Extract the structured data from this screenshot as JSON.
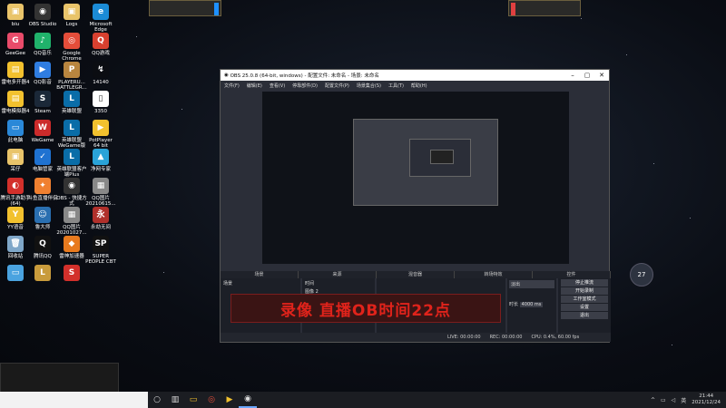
{
  "desktop_icons": [
    {
      "label": "biu",
      "color": "#e9c46a",
      "glyph": "▣"
    },
    {
      "label": "OBS Studio",
      "color": "#333333",
      "glyph": "◉"
    },
    {
      "label": "Logs",
      "color": "#e9c46a",
      "glyph": "▣"
    },
    {
      "label": "Microsoft Edge",
      "color": "#1b8bd6",
      "glyph": "e"
    },
    {
      "label": "GeeGee",
      "color": "#e94b6a",
      "glyph": "G"
    },
    {
      "label": "QQ音乐",
      "color": "#20b26b",
      "glyph": "♪"
    },
    {
      "label": "Google Chrome",
      "color": "#e44d3a",
      "glyph": "◎"
    },
    {
      "label": "QQ游戏",
      "color": "#d8402f",
      "glyph": "Q"
    },
    {
      "label": "雷电多开器4",
      "color": "#f2c12e",
      "glyph": "▤"
    },
    {
      "label": "QQ影音",
      "color": "#2f7de1",
      "glyph": "▶"
    },
    {
      "label": "PLAYERU... BATTLEGR...",
      "color": "#b8853f",
      "glyph": "P"
    },
    {
      "label": "14140",
      "color": "#0b0d12",
      "glyph": "↯"
    },
    {
      "label": "雷电模拟器4",
      "color": "#f2c12e",
      "glyph": "▤"
    },
    {
      "label": "Steam",
      "color": "#1b2838",
      "glyph": "S"
    },
    {
      "label": "英雄联盟",
      "color": "#0a6da8",
      "glyph": "L"
    },
    {
      "label": "3350",
      "color": "#ffffff",
      "glyph": "▯"
    },
    {
      "label": "此电脑",
      "color": "#2a88d8",
      "glyph": "▭"
    },
    {
      "label": "WeGame",
      "color": "#cc2b2b",
      "glyph": "W"
    },
    {
      "label": "英雄联盟 WeGame版",
      "color": "#0a6da8",
      "glyph": "L"
    },
    {
      "label": "PotPlayer 64 bit",
      "color": "#f2c12e",
      "glyph": "▶"
    },
    {
      "label": "呆仔",
      "color": "#e9c46a",
      "glyph": "▣"
    },
    {
      "label": "电脑管家",
      "color": "#1f72d1",
      "glyph": "✓"
    },
    {
      "label": "英雄联盟客户端Plus",
      "color": "#0a6da8",
      "glyph": "L"
    },
    {
      "label": "净网专家",
      "color": "#2aa3d8",
      "glyph": "▲"
    },
    {
      "label": "腾讯手游助手(64)",
      "color": "#d3302b",
      "glyph": "◐"
    },
    {
      "label": "斗鱼直播伴侣",
      "color": "#f08030",
      "glyph": "✦"
    },
    {
      "label": "OBS - 快捷方式",
      "color": "#333333",
      "glyph": "◉"
    },
    {
      "label": "QQ图片 20210615...",
      "color": "#888888",
      "glyph": "▦"
    },
    {
      "label": "YY语音",
      "color": "#f2c12e",
      "glyph": "Y"
    },
    {
      "label": "鲁大师",
      "color": "#2a6fb0",
      "glyph": "☺"
    },
    {
      "label": "QQ图片 20201027...",
      "color": "#888888",
      "glyph": "▦"
    },
    {
      "label": "永劫无间",
      "color": "#b0302b",
      "glyph": "永"
    },
    {
      "label": "回收站",
      "color": "#7fa7c9",
      "glyph": "🗑"
    },
    {
      "label": "腾讯QQ",
      "color": "#111111",
      "glyph": "Q"
    },
    {
      "label": "雷神加速器",
      "color": "#e87a1e",
      "glyph": "◆"
    },
    {
      "label": "SUPER PEOPLE CBT",
      "color": "#111111",
      "glyph": "SP"
    },
    {
      "label": "",
      "color": "#4aa3e0",
      "glyph": "▭"
    },
    {
      "label": "",
      "color": "#c89b3c",
      "glyph": "L"
    },
    {
      "label": "",
      "color": "#d3302b",
      "glyph": "S"
    }
  ],
  "obs": {
    "title": "OBS 25.0.8 (64-bit, windows) - 配置文件: 未命名 - 场景: 未命名",
    "menu": [
      "文件(F)",
      "编辑(E)",
      "查看(V)",
      "停靠部件(D)",
      "配置文件(P)",
      "场景集合(S)",
      "工具(T)",
      "帮助(H)"
    ],
    "docks": [
      "场景",
      "来源",
      "混音器",
      "转场特效",
      "控件"
    ],
    "scene_item": "场景",
    "sources": [
      "时间",
      "图像 2"
    ],
    "transition": "淡出",
    "duration_label": "时长",
    "duration_value": "4000 ms",
    "controls": [
      "停止推流",
      "开始录制",
      "工作室模式",
      "设置",
      "退出"
    ],
    "status": [
      "LIVE: 00:00:00",
      "REC: 00:00:00",
      "CPU: 0.4%, 60.00 fps"
    ]
  },
  "banner_text": "录像 直播OB时间22点",
  "widget_text": "27",
  "clock": {
    "time": "21:44",
    "date": "2021/12/24"
  }
}
